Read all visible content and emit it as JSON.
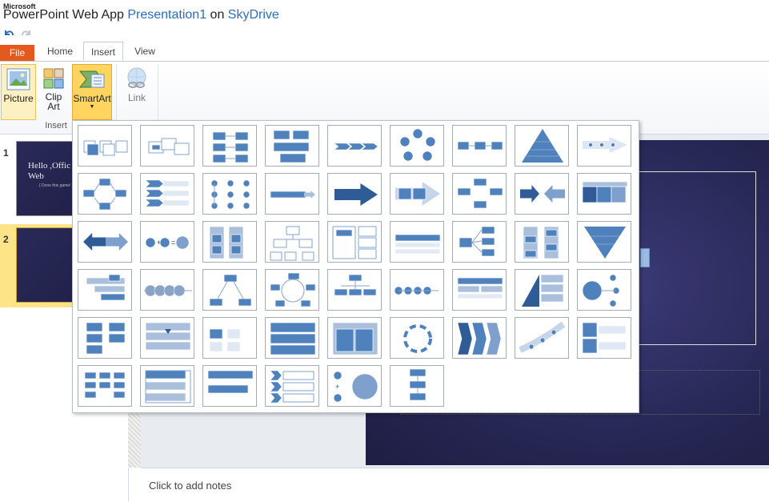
{
  "app": {
    "brand": "Microsoft",
    "product": "PowerPoint Web App",
    "document": "Presentation1",
    "on": "on",
    "location": "SkyDrive"
  },
  "qat": {
    "undo_icon": "undo-icon",
    "redo_icon": "redo-icon"
  },
  "tabs": {
    "file": "File",
    "home": "Home",
    "insert": "Insert",
    "view": "View"
  },
  "ribbon": {
    "picture": "Picture",
    "clipart_line1": "Clip",
    "clipart_line2": "Art",
    "smartart": "SmartArt",
    "link": "Link",
    "group": "Insert"
  },
  "slides": [
    {
      "number": "1",
      "title_line1": "Hello ,Offic",
      "title_line2": "Web",
      "subtitle": "{ Done this game!"
    },
    {
      "number": "2"
    }
  ],
  "notes": {
    "placeholder": "Click to add notes"
  },
  "colors": {
    "accent": "#4f81bd",
    "file_tab": "#e35a1c",
    "slide_bg": "#24244f"
  },
  "smartart_gallery": {
    "rows": [
      [
        "basic-block-list",
        "alternating-picture-blocks",
        "vertical-chevron-list",
        "grouped-list",
        "basic-chevron-process",
        "basic-cycle",
        "basic-process",
        "basic-pyramid",
        "process-arrows"
      ],
      [
        "cycle-matrix",
        "stacked-list",
        "vertical-circle-list",
        "horizontal-bullet-list",
        "up-arrow",
        "accent-process",
        "segmented-cycle",
        "converging-arrows",
        "table-list"
      ],
      [
        "opposing-arrows",
        "equation",
        "vertical-box-list",
        "hierarchy",
        "horizontal-hierarchy",
        "lined-list",
        "radial-list",
        "vertical-arrow-list",
        "inverted-pyramid"
      ],
      [
        "descending-block-list",
        "continuous-block",
        "basic-radial",
        "block-cycle",
        "organization-chart",
        "circle-process",
        "table-hierarchy",
        "stacked-pyramid",
        "radial-cluster"
      ],
      [
        "alternating-flow",
        "staggered-process",
        "pie-process",
        "picture-caption-list",
        "nested-target",
        "continuous-cycle",
        "closed-chevron",
        "up-arrow-curve",
        "vertical-picture-list"
      ],
      [
        "labeled-hierarchy",
        "horizontal-list",
        "bending-process",
        "chevron-list",
        "gear-equation",
        "vertical-process"
      ]
    ]
  }
}
